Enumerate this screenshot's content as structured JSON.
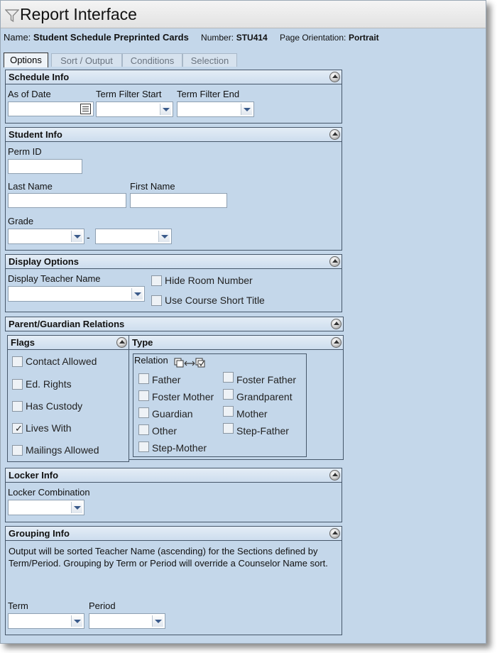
{
  "window": {
    "title": "Report Interface"
  },
  "header": {
    "name_label": "Name:",
    "name_value": "Student Schedule Preprinted Cards",
    "number_label": "Number:",
    "number_value": "STU414",
    "orientation_label": "Page Orientation:",
    "orientation_value": "Portrait"
  },
  "tabs": [
    {
      "label": "Options",
      "active": true
    },
    {
      "label": "Sort / Output",
      "active": false
    },
    {
      "label": "Conditions",
      "active": false
    },
    {
      "label": "Selection",
      "active": false
    }
  ],
  "schedule_info": {
    "title": "Schedule Info",
    "as_of_date_label": "As of Date",
    "as_of_date_value": "",
    "term_filter_start_label": "Term Filter Start",
    "term_filter_start_value": "",
    "term_filter_end_label": "Term Filter End",
    "term_filter_end_value": ""
  },
  "student_info": {
    "title": "Student Info",
    "perm_id_label": "Perm ID",
    "perm_id_value": "",
    "last_name_label": "Last Name",
    "last_name_value": "",
    "first_name_label": "First Name",
    "first_name_value": "",
    "grade_label": "Grade",
    "grade_from": "",
    "grade_separator": "-",
    "grade_to": ""
  },
  "display_options": {
    "title": "Display Options",
    "display_teacher_name_label": "Display Teacher Name",
    "display_teacher_name_value": "",
    "hide_room_number_label": "Hide Room Number",
    "use_course_short_title_label": "Use Course Short Title"
  },
  "parent_guardian": {
    "title": "Parent/Guardian Relations",
    "flags_title": "Flags",
    "flags": [
      {
        "label": "Contact Allowed",
        "checked": false
      },
      {
        "label": "Ed. Rights",
        "checked": false
      },
      {
        "label": "Has Custody",
        "checked": false
      },
      {
        "label": "Lives With",
        "checked": true
      },
      {
        "label": "Mailings Allowed",
        "checked": false
      }
    ],
    "type_title": "Type",
    "relation_label": "Relation",
    "relations": [
      {
        "label": "Father",
        "checked": false
      },
      {
        "label": "Foster Father",
        "checked": false
      },
      {
        "label": "Foster Mother",
        "checked": false
      },
      {
        "label": "Grandparent",
        "checked": false
      },
      {
        "label": "Guardian",
        "checked": false
      },
      {
        "label": "Mother",
        "checked": false
      },
      {
        "label": "Other",
        "checked": false
      },
      {
        "label": "Step-Father",
        "checked": false
      },
      {
        "label": "Step-Mother",
        "checked": false
      }
    ]
  },
  "locker_info": {
    "title": "Locker Info",
    "locker_combination_label": "Locker Combination",
    "locker_combination_value": ""
  },
  "grouping_info": {
    "title": "Grouping Info",
    "description": "Output will be sorted Teacher Name (ascending) for the Sections defined by Term/Period. Grouping by Term or Period will override a Counselor Name sort.",
    "term_label": "Term",
    "term_value": "",
    "period_label": "Period",
    "period_value": ""
  }
}
